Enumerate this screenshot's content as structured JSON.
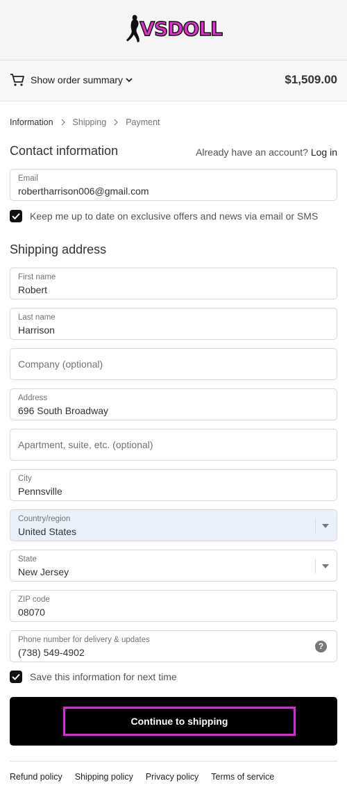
{
  "brand": {
    "logo_text": "VSDOLL",
    "accent": "#e62fd1"
  },
  "summary": {
    "toggle_label": "Show order summary",
    "total": "$1,509.00"
  },
  "breadcrumb": {
    "step1": "Information",
    "step2": "Shipping",
    "step3": "Payment"
  },
  "contact": {
    "title": "Contact information",
    "account_prompt": "Already have an account?",
    "login_link": "Log in",
    "email_label": "Email",
    "email_value": "robertharrison006@gmail.com",
    "marketing_label": "Keep me up to date on exclusive offers and news via email or SMS"
  },
  "shipping": {
    "title": "Shipping address",
    "first_name_label": "First name",
    "first_name_value": "Robert",
    "last_name_label": "Last name",
    "last_name_value": "Harrison",
    "company_placeholder": "Company (optional)",
    "address_label": "Address",
    "address_value": "696 South Broadway",
    "apartment_placeholder": "Apartment, suite, etc. (optional)",
    "city_label": "City",
    "city_value": "Pennsville",
    "country_label": "Country/region",
    "country_value": "United States",
    "state_label": "State",
    "state_value": "New Jersey",
    "zip_label": "ZIP code",
    "zip_value": "08070",
    "phone_label": "Phone number for delivery & updates",
    "phone_value": "(738) 549-4902",
    "save_info_label": "Save this information for next time"
  },
  "actions": {
    "continue_label": "Continue to shipping"
  },
  "footer": {
    "refund": "Refund policy",
    "shipping": "Shipping policy",
    "privacy": "Privacy policy",
    "terms": "Terms of service"
  }
}
